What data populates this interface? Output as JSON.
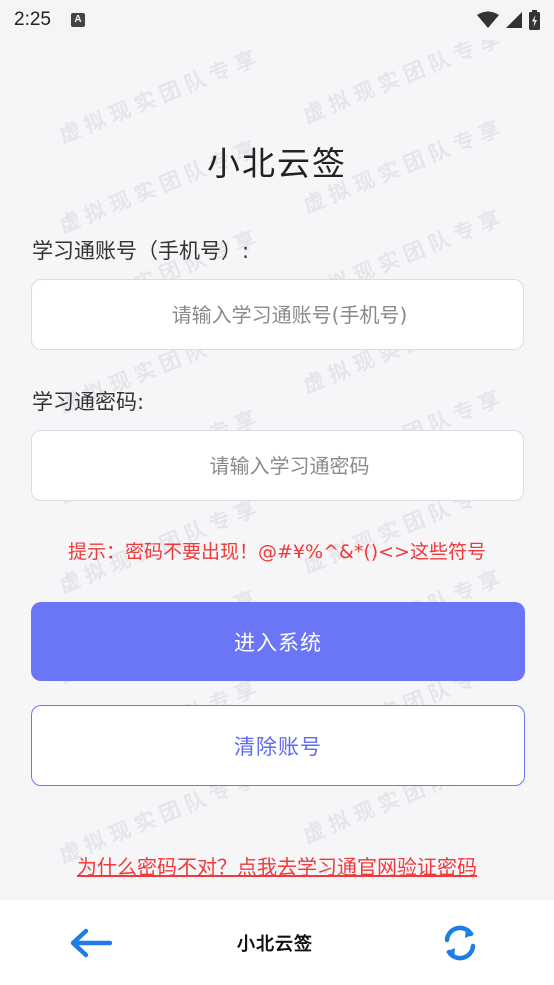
{
  "status_bar": {
    "time": "2:25",
    "app_icon_letter": "A"
  },
  "watermark": "虚拟现实团队专享",
  "page": {
    "title": "小北云签",
    "account_label": "学习通账号（手机号）:",
    "account_placeholder": "请输入学习通账号(手机号)",
    "password_label": "学习通密码:",
    "password_placeholder": "请输入学习通密码",
    "hint": "提示：密码不要出现！@#¥%^&*()<>这些符号",
    "enter_button": "进入系统",
    "clear_button": "清除账号",
    "verify_link": "为什么密码不对？点我去学习通官网验证密码"
  },
  "bottom_bar": {
    "title": "小北云签"
  },
  "colors": {
    "accent": "#6b76f7",
    "hint_red": "#ee3a3a",
    "nav_blue": "#1a7de8"
  }
}
